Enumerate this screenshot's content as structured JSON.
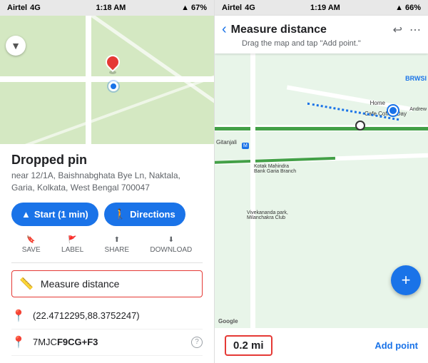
{
  "left": {
    "statusBar": {
      "carrier": "Airtel",
      "network": "4G",
      "time": "1:18 AM",
      "battery": "67%"
    },
    "pinTitle": "Dropped pin",
    "pinAddress": "near 12/1A, Baishnabghata Bye Ln, Naktala, Garia,\nKolkata, West Bengal 700047",
    "btnStart": "Start (1 min)",
    "btnDirections": "Directions",
    "actions": [
      {
        "icon": "🔖",
        "label": "SAVE"
      },
      {
        "icon": "🚩",
        "label": "LABEL"
      },
      {
        "icon": "⬆",
        "label": "SHARE"
      },
      {
        "icon": "⬇",
        "label": "DOWNLOAD"
      }
    ],
    "menuItem": "Measure distance",
    "coordinates": "(22.4712295,88.3752247)",
    "plusCode": "7MJC",
    "plusCodeBold": "F9CG+F3"
  },
  "right": {
    "statusBar": {
      "carrier": "Airtel",
      "network": "4G",
      "time": "1:19 AM",
      "battery": "66%"
    },
    "headerTitle": "Measure distance",
    "headerSubtitle": "Drag the map and tap \"Add point.\"",
    "distance": "0.2 mi",
    "addPoint": "Add point",
    "mapLabels": {
      "brwsi": "BRWSI",
      "gitanjali": "Gitanjali",
      "home": "Home",
      "cafe": "Cafe Coffee Day",
      "kotak": "Kotak Mahindra\nBank Garia Branch",
      "vivekananda": "Vivekananda park,\nMilanchakra Club",
      "google": "Google",
      "andrew": "Andrew"
    }
  }
}
